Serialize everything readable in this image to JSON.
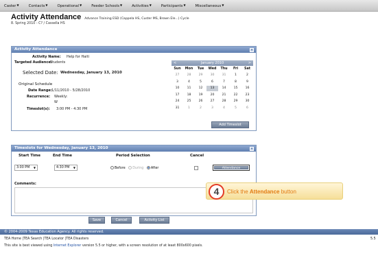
{
  "nav": {
    "items": [
      "Caster",
      "Contacts",
      "Operational",
      "Feeder Schools",
      "Activities",
      "Participants",
      "Miscellaneous"
    ]
  },
  "header": {
    "title": "Activity Attendance",
    "detail": "Advance Training ESD (Cappela HS, Custer MS, Brown Ele...) Cycle",
    "subtitle": "8. Spring 2010 - C? / Cassella HS"
  },
  "attendance_panel": {
    "title": "Activity Attendance",
    "activity_name_label": "Activity Name:",
    "activity_name": "Help for Haiti",
    "audience_label": "Targeted Audience:",
    "audience": "Students",
    "selected_date_label": "Selected Date:",
    "selected_date": "Wednesday, January 13, 2010",
    "original_schedule_label": "Original Schedule",
    "date_range_label": "Date Range:",
    "date_range": "1/11/2010 - 5/28/2010",
    "recurrence_label": "Recurrence:",
    "recurrence": "Weekly:",
    "recurrence_day": "W",
    "timeslots_label": "Timeslot(s):",
    "timeslots": "3:00 PM - 4:30 PM"
  },
  "calendar": {
    "prev": "<",
    "next": ">",
    "month": "January 2010",
    "days_of_week": [
      "Sun",
      "Mon",
      "Tue",
      "Wed",
      "Thu",
      "Fri",
      "Sat"
    ],
    "weeks": [
      [
        "27",
        "28",
        "29",
        "30",
        "31",
        "1",
        "2"
      ],
      [
        "3",
        "4",
        "5",
        "6",
        "7",
        "8",
        "9"
      ],
      [
        "10",
        "11",
        "12",
        "13",
        "14",
        "15",
        "16"
      ],
      [
        "17",
        "18",
        "19",
        "20",
        "21",
        "22",
        "23"
      ],
      [
        "24",
        "25",
        "26",
        "27",
        "28",
        "29",
        "30"
      ],
      [
        "31",
        "1",
        "2",
        "3",
        "4",
        "5",
        "6"
      ]
    ],
    "selected_week": 2,
    "selected_day": 3
  },
  "add_timeslot_label": "Add Timeslot",
  "timeslot_panel": {
    "title": "Timeslots for Wednesday, January 13, 2010",
    "col_start": "Start Time",
    "col_end": "End Time",
    "col_period": "Period Selection",
    "col_cancel": "Cancel",
    "start_value": "3:00 PM",
    "end_value": "4:30 PM",
    "period_before": "Before",
    "period_during": "During",
    "period_after": "After",
    "selected_period": "After",
    "attendance_button": "Attendance",
    "comments_label": "Comments:"
  },
  "actions": {
    "save": "Save",
    "cancel": "Cancel",
    "activity_list": "Activity List"
  },
  "footer": {
    "copyright": "© 2004-2009 Texas Education Agency. All rights reserved.",
    "links": "TEA Home  |TEA Search  |TEA Locator  |TEA Disasters",
    "browser_note_pre": "This site is best viewed using ",
    "browser_note_link": "Internet Explorer",
    "browser_note_post": " version 5.5 or higher, with a screen resolution of at least 800x600 pixels.",
    "version": "5.5"
  },
  "callout": {
    "step": "4",
    "text_pre": "Click the ",
    "text_bold": "Attendance",
    "text_post": " button"
  },
  "colors": {
    "panel_header": "#6f8dbd",
    "callout_text": "#e27a10",
    "step_ring": "#e33b26"
  }
}
